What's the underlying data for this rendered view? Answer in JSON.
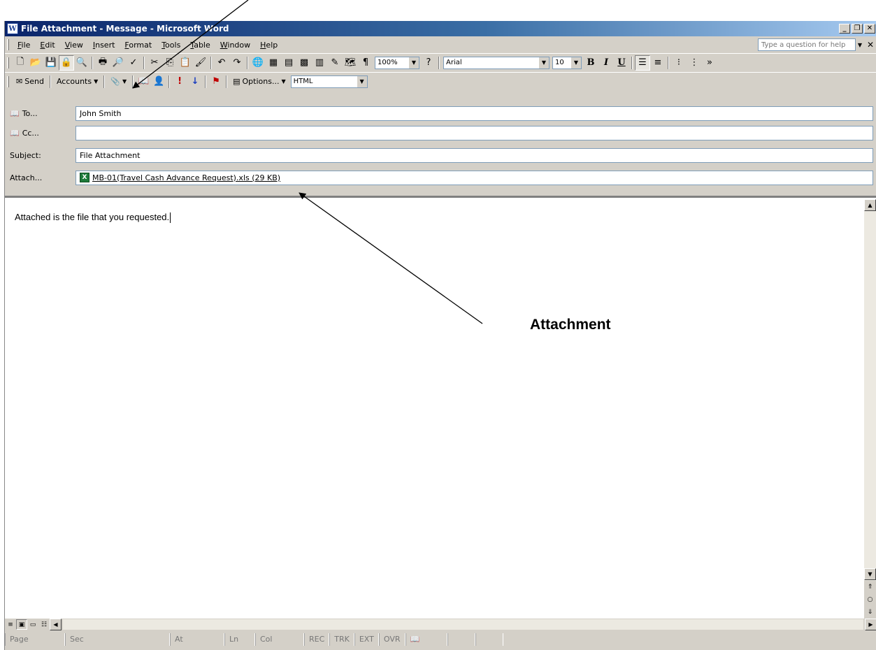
{
  "window": {
    "title": "File Attachment - Message - Microsoft Word",
    "app_icon": "W"
  },
  "menu": {
    "items": [
      "File",
      "Edit",
      "View",
      "Insert",
      "Format",
      "Tools",
      "Table",
      "Window",
      "Help"
    ],
    "help_placeholder": "Type a question for help"
  },
  "toolbar": {
    "zoom": "100%",
    "font_name": "Arial",
    "font_size": "10",
    "bold_label": "B",
    "italic_label": "I",
    "underline_label": "U"
  },
  "email_toolbar": {
    "send_label": "Send",
    "accounts_label": "Accounts",
    "options_label": "Options...",
    "format": "HTML"
  },
  "header": {
    "to_label": "To...",
    "to_value": "John Smith",
    "cc_label": "Cc...",
    "cc_value": "",
    "subject_label": "Subject:",
    "subject_value": "File Attachment",
    "attach_label": "Attach...",
    "attach_value": "MB-01(Travel Cash Advance Request).xls (29 KB)"
  },
  "body": {
    "text": "Attached is the file that you requested."
  },
  "statusbar": {
    "page": "Page",
    "sec": "Sec",
    "at": "At",
    "ln": "Ln",
    "col": "Col",
    "rec": "REC",
    "trk": "TRK",
    "ext": "EXT",
    "ovr": "OVR"
  },
  "annotation": {
    "label": "Attachment"
  }
}
